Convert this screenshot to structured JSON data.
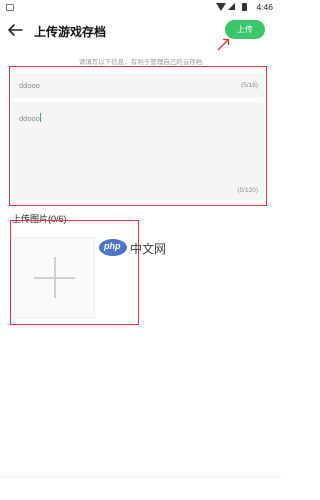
{
  "status_bar": {
    "time": "4:46"
  },
  "header": {
    "title": "上传游戏存档",
    "upload_label": "上传"
  },
  "hint": "请填写以下信息，有利于管理自己的云存档",
  "form": {
    "title_value": "ddooo",
    "title_count": "(5/16)",
    "desc_value": "ddooo",
    "desc_count": "(5/120)"
  },
  "images": {
    "label": "上传图片(0/6)"
  },
  "watermark": {
    "badge": "php",
    "text": "中文网"
  },
  "colors": {
    "accent": "#3bc66b",
    "annotation": "#e3363c"
  }
}
